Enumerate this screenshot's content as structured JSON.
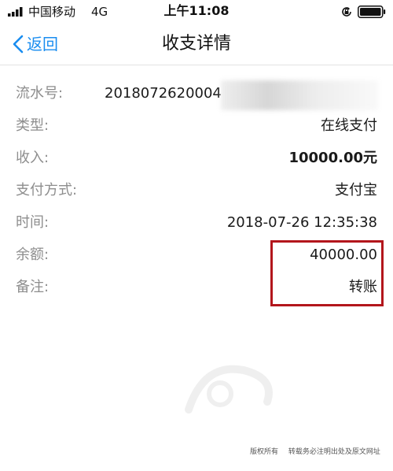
{
  "status_bar": {
    "carrier": "中国移动",
    "network": "4G",
    "time": "上午11:08"
  },
  "nav": {
    "back_label": "返回",
    "title": "收支详情"
  },
  "details": {
    "serial": {
      "label": "流水号:",
      "value": "2018072620004"
    },
    "type": {
      "label": "类型:",
      "value": "在线支付"
    },
    "income": {
      "label": "收入:",
      "value": "10000.00元"
    },
    "payment_method": {
      "label": "支付方式:",
      "value": "支付宝"
    },
    "time": {
      "label": "时间:",
      "value": "2018-07-26 12:35:38"
    },
    "balance": {
      "label": "余额:",
      "value": "40000.00"
    },
    "remark": {
      "label": "备注:",
      "value": "转账"
    }
  },
  "footer": {
    "copyright": "版权所有",
    "notice": "转载务必注明出处及原文网址"
  },
  "colors": {
    "accent": "#1a8df0",
    "highlight_border": "#b3161c",
    "label_gray": "#8e8e8e"
  }
}
